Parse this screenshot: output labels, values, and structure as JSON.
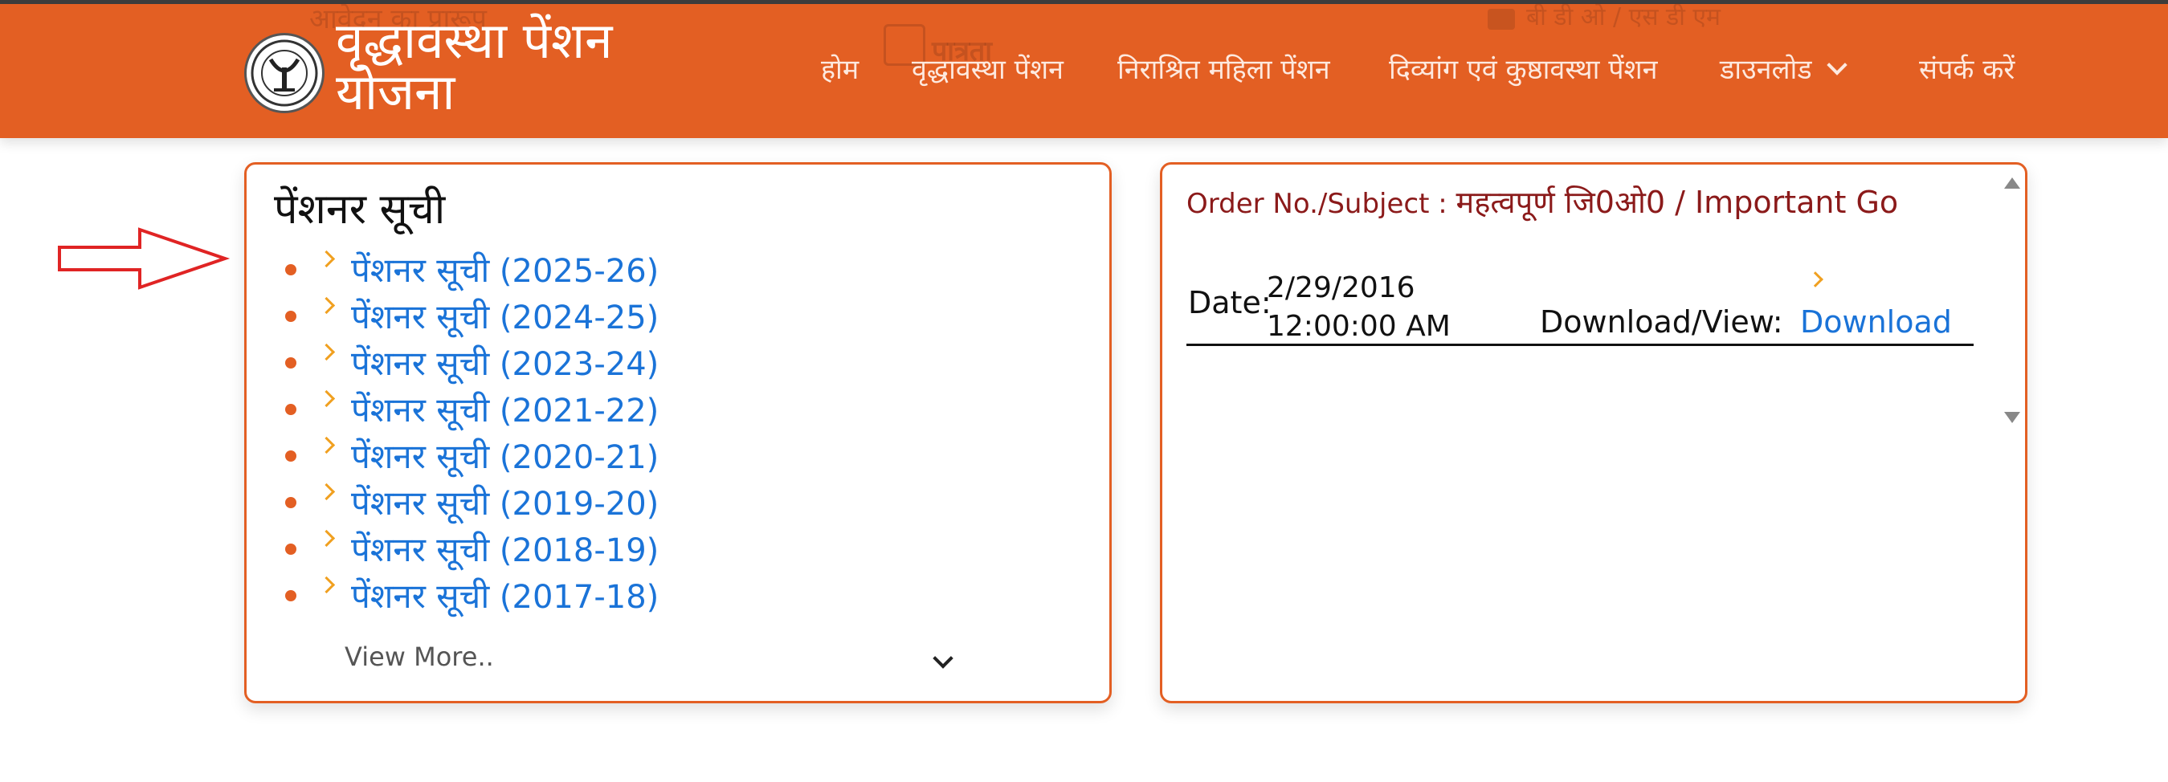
{
  "header": {
    "site_title": "वृद्धावस्था पेंशन योजना",
    "nav": [
      {
        "label": "होम"
      },
      {
        "label": "वृद्धावस्था पेंशन"
      },
      {
        "label": "निराश्रित महिला पेंशन"
      },
      {
        "label": "दिव्यांग एवं कुष्ठावस्था पेंशन"
      },
      {
        "label": "डाउनलोड"
      },
      {
        "label": "संपर्क करें"
      }
    ],
    "ghost_texts": [
      "आवेदन का प्रारूप",
      "पात्रता",
      "बी डी ओ / एस डी एम"
    ]
  },
  "pensioner_list": {
    "title": "पेंशनर सूची",
    "items": [
      {
        "label": "पेंशनर सूची",
        "year": "(2025-26)"
      },
      {
        "label": "पेंशनर सूची",
        "year": "(2024-25)"
      },
      {
        "label": "पेंशनर सूची",
        "year": "(2023-24)"
      },
      {
        "label": "पेंशनर सूची",
        "year": "(2021-22)"
      },
      {
        "label": "पेंशनर सूची",
        "year": "(2020-21)"
      },
      {
        "label": "पेंशनर सूची",
        "year": "(2019-20)"
      },
      {
        "label": "पेंशनर सूची",
        "year": "(2018-19)"
      },
      {
        "label": "पेंशनर सूची",
        "year": "(2017-18)"
      }
    ],
    "view_more": "View More.."
  },
  "orders": {
    "label_prefix": "Order No./Subject :",
    "subject": "महत्वपूर्ण जि0ओ0 / Important Go",
    "date_label": "Date:",
    "date_line1": "2/29/2016",
    "date_line2": "12:00:00 AM",
    "download_label": "Download/View:",
    "download_link": "Download"
  },
  "colors": {
    "brand_orange": "#e35f23",
    "link_blue": "#1a73d8",
    "chevron_amber": "#f0a020",
    "annotation_red": "#e02424"
  }
}
